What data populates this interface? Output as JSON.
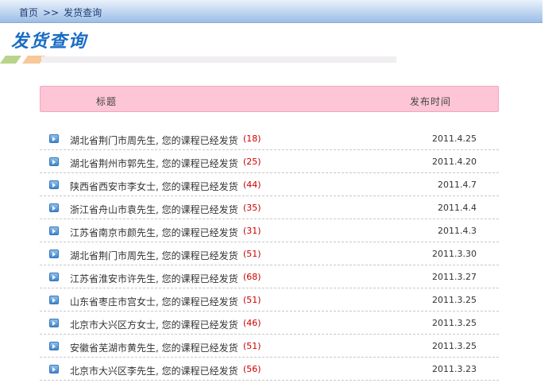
{
  "breadcrumb": {
    "home": "首页",
    "separator": ">>",
    "current": "发货查询"
  },
  "page_title": "发货查询",
  "table": {
    "header_title": "标题",
    "header_date": "发布时间"
  },
  "items": [
    {
      "title": "湖北省荆门市周先生, 您的课程已经发货",
      "count": "(18)",
      "date": "2011.4.25"
    },
    {
      "title": "湖北省荆州市郭先生, 您的课程已经发货",
      "count": "(25)",
      "date": "2011.4.20"
    },
    {
      "title": "陕西省西安市李女士, 您的课程已经发货",
      "count": "(44)",
      "date": "2011.4.7"
    },
    {
      "title": "浙江省舟山市袁先生, 您的课程已经发货",
      "count": "(35)",
      "date": "2011.4.4"
    },
    {
      "title": "江苏省南京市颜先生, 您的课程已经发货",
      "count": "(31)",
      "date": "2011.4.3"
    },
    {
      "title": "湖北省荆门市周先生, 您的课程已经发货",
      "count": "(51)",
      "date": "2011.3.30"
    },
    {
      "title": "江苏省淮安市许先生, 您的课程已经发货",
      "count": "(68)",
      "date": "2011.3.27"
    },
    {
      "title": "山东省枣庄市宫女士, 您的课程已经发货",
      "count": "(51)",
      "date": "2011.3.25"
    },
    {
      "title": "北京市大兴区方女士, 您的课程已经发货",
      "count": "(46)",
      "date": "2011.3.25"
    },
    {
      "title": "安徽省芜湖市黄先生, 您的课程已经发货",
      "count": "(51)",
      "date": "2011.3.25"
    },
    {
      "title": "北京市大兴区李先生, 您的课程已经发货",
      "count": "(56)",
      "date": "2011.3.23"
    }
  ],
  "colors": {
    "accent": "#1a6cc4",
    "header_bg": "#fdc5d5",
    "count": "#cc0000"
  },
  "icons": {
    "bullet": "arrow-bullet-icon"
  }
}
